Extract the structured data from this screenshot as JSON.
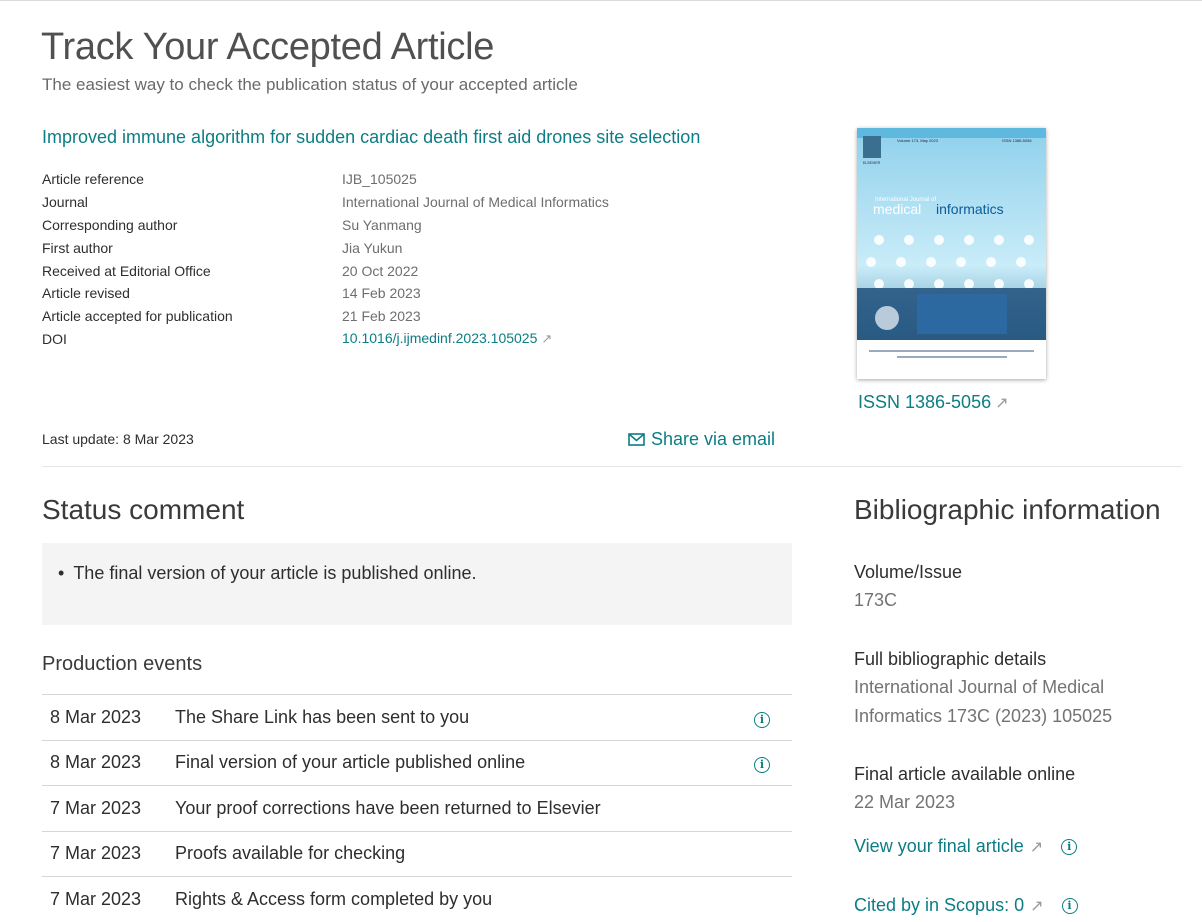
{
  "header": {
    "title": "Track Your Accepted Article",
    "subtitle": "The easiest way to check the publication status of your accepted article"
  },
  "article": {
    "title": "Improved immune algorithm for sudden cardiac death first aid drones site selection",
    "details": [
      {
        "label": "Article reference",
        "value": "IJB_105025"
      },
      {
        "label": "Journal",
        "value": "International Journal of Medical Informatics"
      },
      {
        "label": "Corresponding author",
        "value": "Su Yanmang"
      },
      {
        "label": "First author",
        "value": "Jia Yukun"
      },
      {
        "label": "Received at Editorial Office",
        "value": "20 Oct 2022"
      },
      {
        "label": "Article revised",
        "value": "14 Feb 2023"
      },
      {
        "label": "Article accepted for publication",
        "value": "21 Feb 2023"
      },
      {
        "label": "DOI",
        "value": "10.1016/j.ijmedinf.2023.105025"
      }
    ],
    "last_update_label": "Last update:",
    "last_update_value": "8 Mar 2023",
    "share_label": "Share via email"
  },
  "cover": {
    "issn_label": "ISSN 1386-5056",
    "journal_small": "International Journal of",
    "journal_word1": "medical",
    "journal_word2": "informatics",
    "volume_line": "Volume 173, May 2023",
    "issn_line": "ISSN 1386-5056",
    "publisher": "ELSEVIER"
  },
  "status": {
    "heading": "Status comment",
    "comments": [
      "The final version of your article is published online."
    ]
  },
  "events": {
    "heading": "Production events",
    "rows": [
      {
        "date": "8 Mar 2023",
        "text": "The Share Link has been sent to you",
        "info": true
      },
      {
        "date": "8 Mar 2023",
        "text": "Final version of your article published online",
        "info": true
      },
      {
        "date": "7 Mar 2023",
        "text": "Your proof corrections have been returned to Elsevier",
        "info": false
      },
      {
        "date": "7 Mar 2023",
        "text": "Proofs available for checking",
        "info": false
      },
      {
        "date": "7 Mar 2023",
        "text": "Rights & Access form completed by you",
        "info": false
      }
    ]
  },
  "bibliographic": {
    "heading": "Bibliographic information",
    "volume_label": "Volume/Issue",
    "volume_value": "173C",
    "full_label": "Full bibliographic details",
    "full_value_line1": "International Journal of Medical",
    "full_value_line2": "Informatics 173C (2023) 105025",
    "online_label": "Final article available online",
    "online_value": "22 Mar 2023",
    "view_link": "View your final article",
    "cited_link": "Cited by in Scopus: 0"
  },
  "colors": {
    "accent": "#0c7d84",
    "text": "#2e2e2e",
    "muted": "#6e6e6e",
    "status_bg": "#f4f4f4"
  }
}
